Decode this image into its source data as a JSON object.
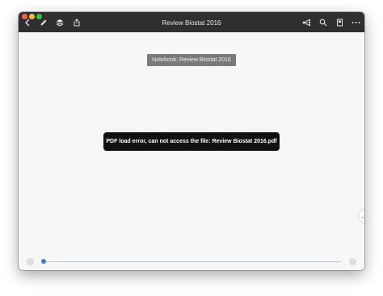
{
  "window": {
    "title": "Review Biostat 2016"
  },
  "toolbar": {
    "left_icons": [
      "back-chevron-icon",
      "pencil-icon",
      "layers-icon",
      "share-icon"
    ],
    "right_icons": [
      "outline-tree-icon",
      "search-icon",
      "bookmark-icon",
      "more-icon"
    ]
  },
  "main": {
    "notebook_label": "Notebook: Review Biostat 2016",
    "error_message": "PDF load error, can not access the file: Review Biostat 2016.pdf"
  },
  "scrubber": {
    "progress": 0
  },
  "colors": {
    "toolbar_bg": "#2f2f2f",
    "canvas_bg": "#f7f7f7",
    "label_bg": "#7a7a7a",
    "toast_bg": "#111111",
    "accent": "#3f7cc8"
  }
}
